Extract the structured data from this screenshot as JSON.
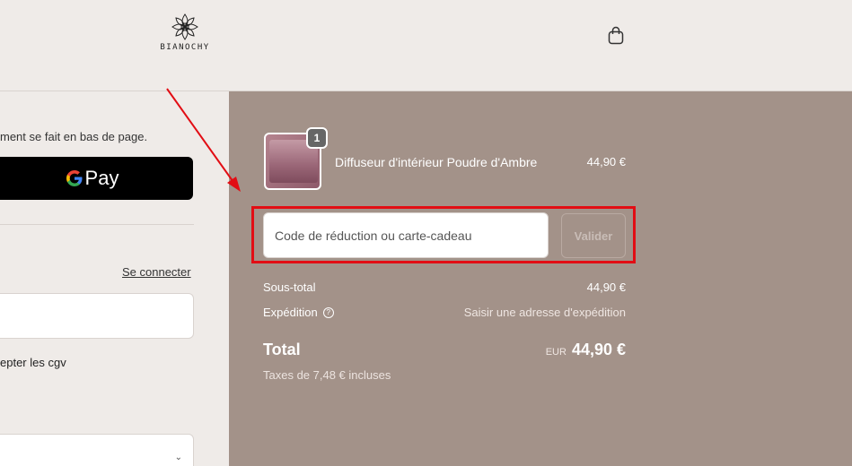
{
  "header": {
    "brand": "BIANOCHY",
    "cart_icon": "shopping-bag-icon"
  },
  "left": {
    "notice": "ment se fait en bas de page.",
    "gpay_label": "Pay",
    "login_link": "Se connecter",
    "cgv_text": "epter les cgv"
  },
  "summary": {
    "product": {
      "name": "Diffuseur d'intérieur Poudre d'Ambre",
      "price": "44,90 €",
      "quantity": "1"
    },
    "discount": {
      "placeholder": "Code de réduction ou carte-cadeau",
      "button_label": "Valider"
    },
    "subtotal_label": "Sous-total",
    "subtotal_value": "44,90 €",
    "shipping_label": "Expédition",
    "shipping_value": "Saisir une adresse d'expédition",
    "total_label": "Total",
    "currency": "EUR",
    "total_value": "44,90 €",
    "tax_note": "Taxes de 7,48 € incluses"
  },
  "colors": {
    "summary_bg": "#a39289",
    "page_bg": "#efebe8",
    "highlight": "#e20d14"
  }
}
